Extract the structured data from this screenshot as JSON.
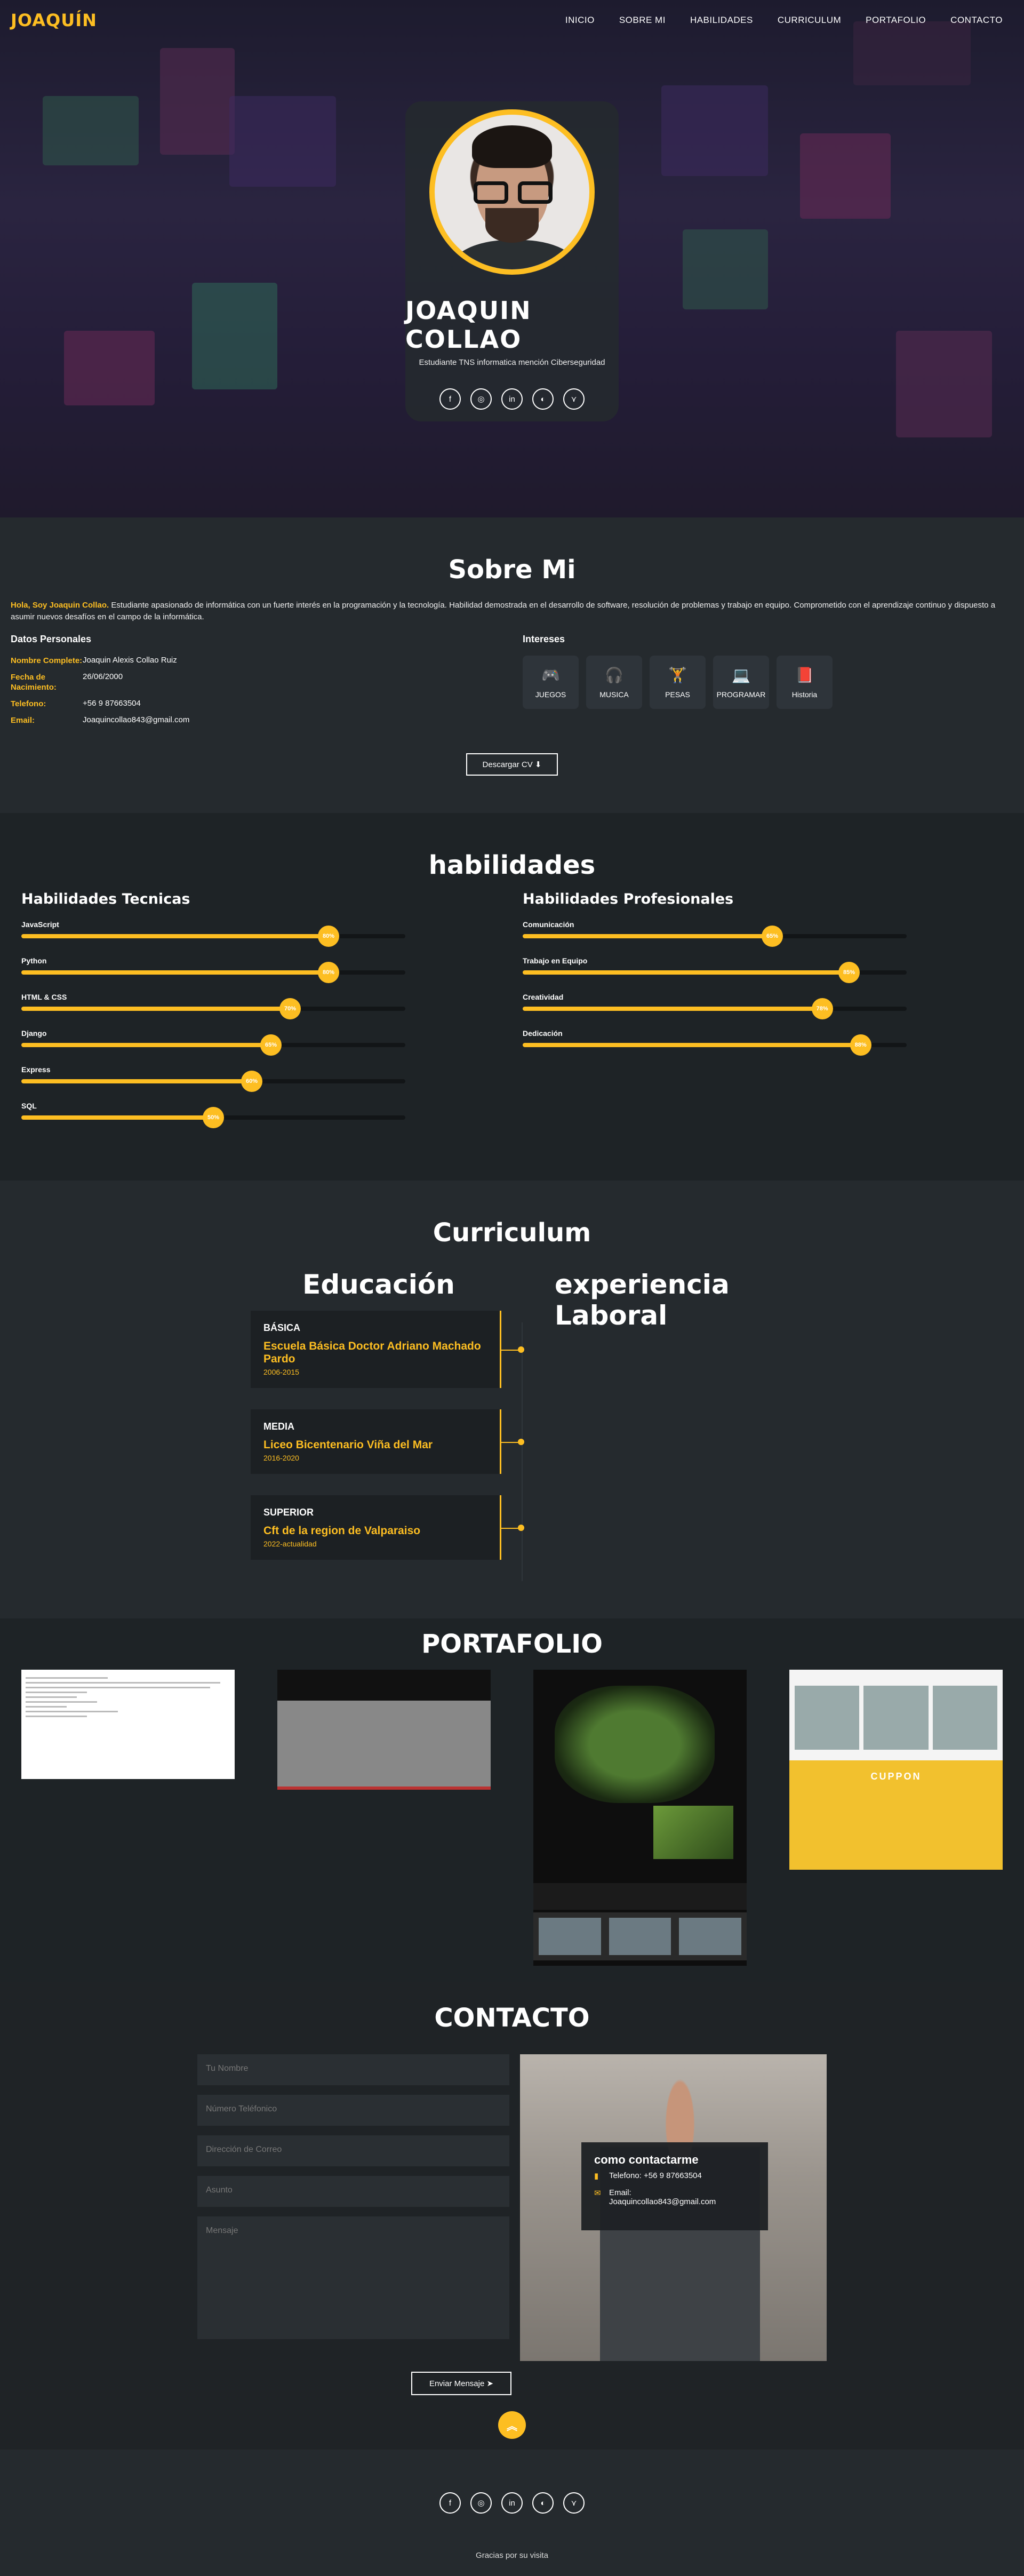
{
  "nav": {
    "logo": "JOAQUÍN",
    "items": [
      "INICIO",
      "SOBRE MI",
      "HABILIDADES",
      "CURRICULUM",
      "PORTAFOLIO",
      "CONTACTO"
    ]
  },
  "hero": {
    "name": "JOAQUIN COLLAO",
    "subtitle": "Estudiante TNS informatica mención Ciberseguridad",
    "socials": [
      {
        "icon": "facebook-icon",
        "glyph": "f"
      },
      {
        "icon": "instagram-icon",
        "glyph": "◎"
      },
      {
        "icon": "linkedin-icon",
        "glyph": "in"
      },
      {
        "icon": "github-icon",
        "glyph": "◐"
      },
      {
        "icon": "bluesky-icon",
        "glyph": "⋎"
      }
    ]
  },
  "sobre": {
    "title": "Sobre Mi",
    "bio_highlight": "Hola, Soy Joaquin Collao.",
    "bio": " Estudiante apasionado de informática con un fuerte interés en la programación y la tecnología. Habilidad demostrada en el desarrollo de software, resolución de problemas y trabajo en equipo. Comprometido con el aprendizaje continuo y dispuesto a asumir nuevos desafíos en el campo de la informática.",
    "datos_title": "Datos Personales",
    "datos": [
      {
        "k": "Nombre Complete:",
        "v": "Joaquin Alexis Collao Ruiz"
      },
      {
        "k": "Fecha de Nacimiento:",
        "v": "26/06/2000"
      },
      {
        "k": "Telefono:",
        "v": "+56 9 87663504"
      },
      {
        "k": "Email:",
        "v": "Joaquincollao843@gmail.com"
      }
    ],
    "intereses_title": "Intereses",
    "intereses": [
      {
        "label": "JUEGOS",
        "icon": "gamepad-icon",
        "glyph": "🎮"
      },
      {
        "label": "MUSICA",
        "icon": "headphones-icon",
        "glyph": "🎧"
      },
      {
        "label": "PESAS",
        "icon": "dumbbell-icon",
        "glyph": "🏋"
      },
      {
        "label": "PROGRAMAR",
        "icon": "laptop-icon",
        "glyph": "💻"
      },
      {
        "label": "Historia",
        "icon": "book-icon",
        "glyph": "📕"
      }
    ],
    "cv_button": "Descargar CV ⬇"
  },
  "habilidades": {
    "title": "habilidades",
    "tecnicas_title": "Habilidades Tecnicas",
    "profesionales_title": "Habilidades Profesionales",
    "tecnicas": [
      {
        "name": "JavaScript",
        "value": 80,
        "label": "80%"
      },
      {
        "name": "Python",
        "value": 80,
        "label": "80%"
      },
      {
        "name": "HTML & CSS",
        "value": 70,
        "label": "70%"
      },
      {
        "name": "Django",
        "value": 65,
        "label": "65%"
      },
      {
        "name": "Express",
        "value": 60,
        "label": "60%"
      },
      {
        "name": "SQL",
        "value": 50,
        "label": "50%"
      }
    ],
    "profesionales": [
      {
        "name": "Comunicación",
        "value": 65,
        "label": "65%"
      },
      {
        "name": "Trabajo en Equipo",
        "value": 85,
        "label": "85%"
      },
      {
        "name": "Creatividad",
        "value": 78,
        "label": "78%"
      },
      {
        "name": "Dedicación",
        "value": 88,
        "label": "88%"
      }
    ]
  },
  "curriculum": {
    "title": "Curriculum",
    "educacion_title": "Educación",
    "experiencia_title": "experiencia Laboral",
    "educacion": [
      {
        "level": "BÁSICA",
        "school": "Escuela Básica Doctor Adriano Machado Pardo",
        "years": "2006-2015"
      },
      {
        "level": "MEDIA",
        "school": "Liceo Bicentenario Viña del Mar",
        "years": "2016-2020"
      },
      {
        "level": "SUPERIOR",
        "school": "Cft de la region de Valparaiso",
        "years": "2022-actualidad"
      }
    ]
  },
  "portafolio": {
    "title": "PORTAFOLIO",
    "cupp_label": "CUPPON"
  },
  "contacto": {
    "title": "CONTACTO",
    "fields": [
      "Tu Nombre",
      "Número Teléfonico",
      "Dirección de Correo",
      "Asunto"
    ],
    "message_placeholder": "Mensaje",
    "send_button": "Enviar Mensaje ➤",
    "card_title": "como contactarme",
    "card_phone": "Telefono: +56 9 87663504",
    "card_email_label": "Email:",
    "card_email": "Joaquincollao843@gmail.com"
  },
  "footer": {
    "thanks": "Gracias por su visita"
  },
  "colors": {
    "accent": "#fdbe22",
    "background": "#252a2e"
  }
}
